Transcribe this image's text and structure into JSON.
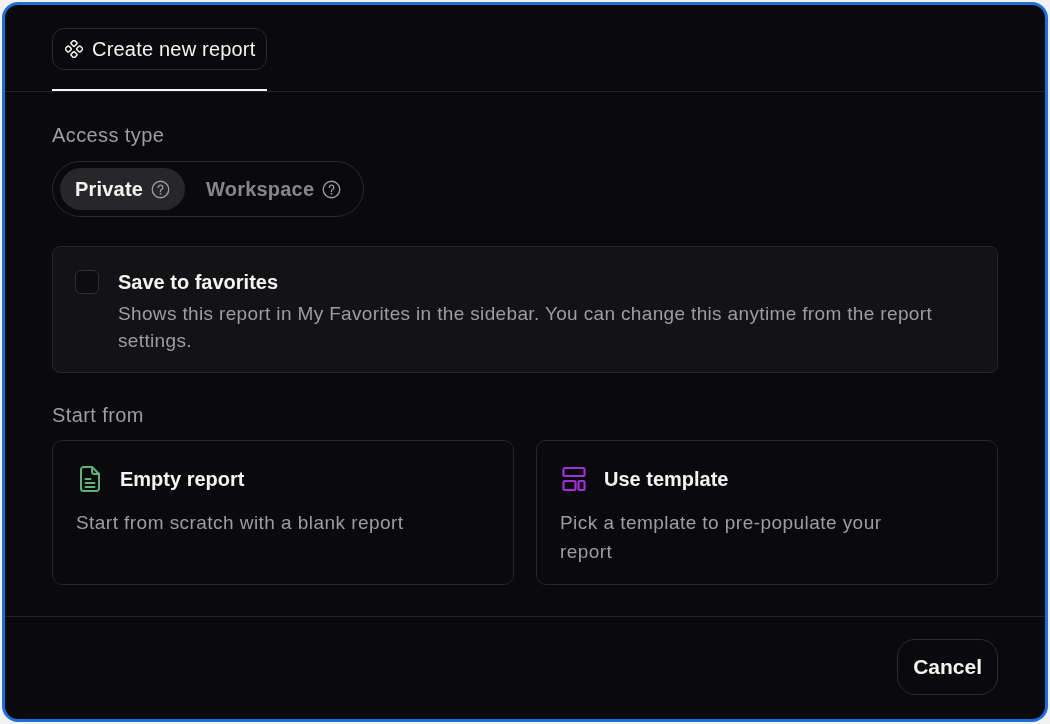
{
  "tabs": [
    {
      "label": "Create new report",
      "selected": true
    }
  ],
  "access_type": {
    "label": "Access type",
    "options": [
      {
        "label": "Private",
        "selected": true
      },
      {
        "label": "Workspace",
        "selected": false
      }
    ]
  },
  "favorites": {
    "title": "Save to favorites",
    "description": "Shows this report in My Favorites in the sidebar. You can change this anytime from the report settings.",
    "checked": false
  },
  "start_from": {
    "label": "Start from",
    "options": [
      {
        "kind": "empty",
        "title": "Empty report",
        "description": "Start from scratch with a blank report"
      },
      {
        "kind": "template",
        "title": "Use template",
        "description": "Pick a template to pre-populate your report"
      }
    ]
  },
  "buttons": [
    {
      "label": "Cancel"
    }
  ]
}
